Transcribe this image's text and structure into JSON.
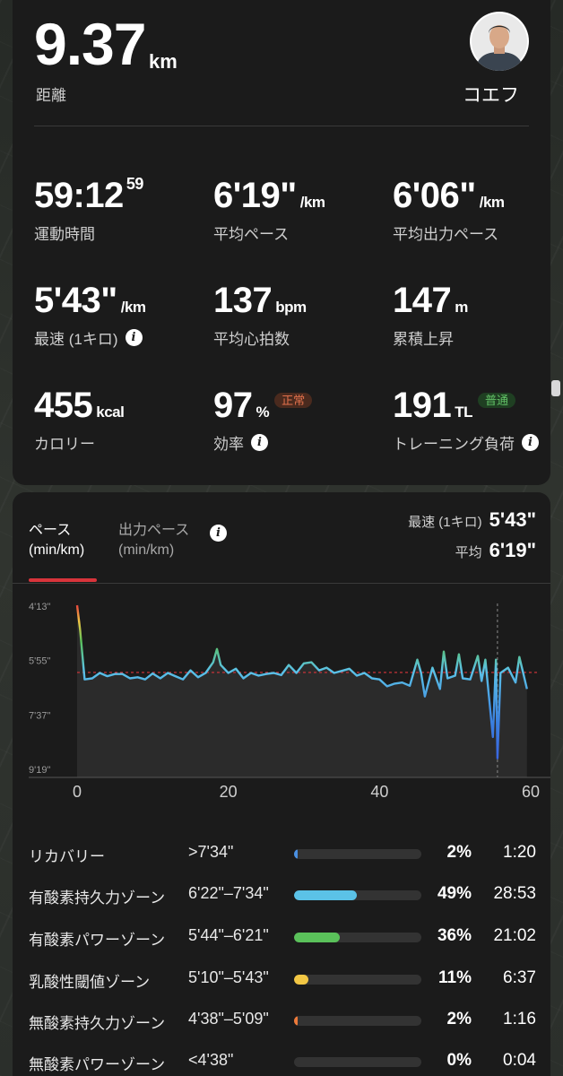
{
  "header": {
    "distance_value": "9.37",
    "distance_unit": "km",
    "distance_label": "距離",
    "user_name": "コエフ"
  },
  "stats": [
    {
      "value": "59:12",
      "sup": "59",
      "unit": "",
      "label": "運動時間"
    },
    {
      "value": "6'19\"",
      "unit": "/km",
      "label": "平均ペース"
    },
    {
      "value": "6'06\"",
      "unit": "/km",
      "label": "平均出力ペース"
    },
    {
      "value": "5'43\"",
      "unit": "/km",
      "label": "最速 (1キロ)"
    },
    {
      "value": "137",
      "unit": "bpm",
      "label": "平均心拍数"
    },
    {
      "value": "147",
      "unit": "m",
      "label": "累積上昇"
    },
    {
      "value": "455",
      "unit": "kcal",
      "label": "カロリー"
    },
    {
      "value": "97",
      "unit": "%",
      "label": "効率",
      "badge": "正常"
    },
    {
      "value": "191",
      "unit": "TL",
      "label": "トレーニング負荷",
      "badge": "普通"
    }
  ],
  "chart_card": {
    "tab_pace": "ペース\n(min/km)",
    "tab_power": "出力ペース\n(min/km)",
    "fastest_label": "最速 (1キロ)",
    "fastest_value": "5'43\"",
    "avg_label": "平均",
    "avg_value": "6'19\""
  },
  "chart_data": {
    "type": "area",
    "y_tick_labels": [
      "4'13\"",
      "5'55\"",
      "7'37\"",
      "9'19\""
    ],
    "x_tick_labels": [
      "0",
      "20",
      "40",
      "60"
    ],
    "xlim": [
      0,
      60
    ],
    "ylim_seconds": [
      253,
      559
    ],
    "average_seconds": 379,
    "marker_x": 55.6,
    "series": [
      {
        "x": [
          0,
          0.4,
          1,
          2,
          3,
          4,
          5,
          6,
          7,
          8,
          9,
          10,
          11,
          12,
          13,
          14,
          15,
          16,
          17,
          18,
          18.5,
          19,
          20,
          21,
          22,
          23,
          24,
          25,
          26,
          27,
          28,
          29,
          30,
          31,
          32,
          33,
          34,
          35,
          36,
          37,
          38,
          39,
          40,
          41,
          42,
          43,
          44,
          45,
          45.5,
          46,
          47,
          48,
          48.5,
          49,
          50,
          50.5,
          51,
          52,
          53,
          53.5,
          54,
          55,
          55.4,
          55.6,
          56,
          57,
          58,
          58.5,
          59,
          59.5
        ],
        "pace_seconds": [
          253,
          300,
          392,
          390,
          380,
          386,
          382,
          382,
          390,
          388,
          392,
          381,
          390,
          380,
          386,
          392,
          375,
          388,
          380,
          360,
          335,
          365,
          380,
          372,
          390,
          380,
          385,
          382,
          380,
          384,
          365,
          380,
          362,
          360,
          375,
          370,
          380,
          376,
          372,
          385,
          380,
          390,
          392,
          405,
          400,
          398,
          404,
          355,
          380,
          424,
          370,
          410,
          340,
          390,
          385,
          345,
          390,
          392,
          348,
          395,
          355,
          500,
          355,
          540,
          380,
          370,
          398,
          350,
          380,
          410
        ]
      }
    ]
  },
  "zones": [
    {
      "name": "リカバリー",
      "range": ">7'34\"",
      "pct": "2%",
      "fill": 0.02,
      "color": "#4a90e2",
      "time": "1:20"
    },
    {
      "name": "有酸素持久力ゾーン",
      "range": "6'22\"–7'34\"",
      "pct": "49%",
      "fill": 0.49,
      "color": "#5bc2e7",
      "time": "28:53"
    },
    {
      "name": "有酸素パワーゾーン",
      "range": "5'44\"–6'21\"",
      "pct": "36%",
      "fill": 0.36,
      "color": "#5ac15a",
      "time": "21:02"
    },
    {
      "name": "乳酸性閾値ゾーン",
      "range": "5'10\"–5'43\"",
      "pct": "11%",
      "fill": 0.11,
      "color": "#f2c744",
      "time": "6:37"
    },
    {
      "name": "無酸素持久力ゾーン",
      "range": "4'38\"–5'09\"",
      "pct": "2%",
      "fill": 0.02,
      "color": "#ee7a3a",
      "time": "1:16"
    },
    {
      "name": "無酸素パワーゾーン",
      "range": "<4'38\"",
      "pct": "0%",
      "fill": 0.0,
      "color": "#e8453c",
      "time": "0:04"
    }
  ]
}
